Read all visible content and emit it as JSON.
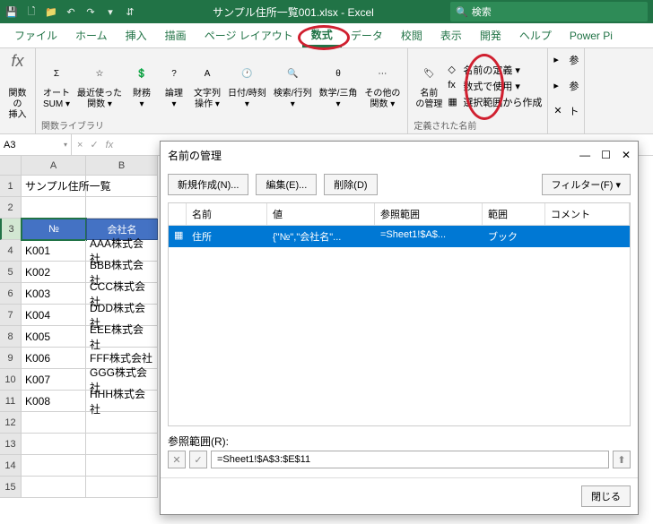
{
  "titlebar": {
    "doc_title": "サンプル住所一覧001.xlsx - Excel",
    "search_placeholder": "検索"
  },
  "tabs": [
    "ファイル",
    "ホーム",
    "挿入",
    "描画",
    "ページ レイアウト",
    "数式",
    "データ",
    "校閲",
    "表示",
    "開発",
    "ヘルプ",
    "Power Pi"
  ],
  "active_tab_index": 5,
  "ribbon": {
    "fx": {
      "label1": "関数の",
      "label2": "挿入"
    },
    "autosum": {
      "label1": "オート",
      "label2": "SUM ▾"
    },
    "recent": {
      "label1": "最近使った",
      "label2": "関数 ▾"
    },
    "financial": {
      "label": "財務",
      "drop": "▾"
    },
    "logical": {
      "label": "論理",
      "drop": "▾"
    },
    "text": {
      "label1": "文字列",
      "label2": "操作 ▾"
    },
    "date": {
      "label": "日付/時刻",
      "drop": "▾"
    },
    "lookup": {
      "label": "検索/行列",
      "drop": "▾"
    },
    "math": {
      "label": "数学/三角",
      "drop": "▾"
    },
    "other": {
      "label1": "その他の",
      "label2": "関数 ▾"
    },
    "group_lib": "関数ライブラリ",
    "name_mgr": {
      "label1": "名前",
      "label2": "の管理"
    },
    "define": "名前の定義 ▾",
    "use": "数式で使用 ▾",
    "create": "選択範囲から作成",
    "group_names": "定義された名前",
    "dep_group": {
      "item1": "参",
      "item2": "参",
      "item3": "ト"
    }
  },
  "name_box": "A3",
  "formula_icons": {
    "x": "×",
    "check": "✓",
    "fx": "fx"
  },
  "sheet": {
    "cols": [
      "A",
      "B"
    ],
    "title_cell": "サンプル住所一覧",
    "header_row": {
      "a": "№",
      "b": "会社名"
    },
    "rows": [
      {
        "a": "K001",
        "b": "AAA株式会社"
      },
      {
        "a": "K002",
        "b": "BBB株式会社"
      },
      {
        "a": "K003",
        "b": "CCC株式会社"
      },
      {
        "a": "K004",
        "b": "DDD株式会社"
      },
      {
        "a": "K005",
        "b": "EEE株式会社"
      },
      {
        "a": "K006",
        "b": "FFF株式会社"
      },
      {
        "a": "K007",
        "b": "GGG株式会社"
      },
      {
        "a": "K008",
        "b": "HHH株式会社"
      }
    ]
  },
  "dialog": {
    "title": "名前の管理",
    "new_btn": "新規作成(N)...",
    "edit_btn": "編集(E)...",
    "delete_btn": "削除(D)",
    "filter_btn": "フィルター(F) ▾",
    "columns": {
      "name": "名前",
      "value": "値",
      "ref": "参照範囲",
      "scope": "範囲",
      "comment": "コメント"
    },
    "row": {
      "name": "住所",
      "value": "{\"№\",\"会社名\"...",
      "ref": "=Sheet1!$A$...",
      "scope": "ブック",
      "comment": ""
    },
    "ref_label": "参照範囲(R):",
    "ref_value": "=Sheet1!$A$3:$E$11",
    "close_btn": "閉じる"
  }
}
